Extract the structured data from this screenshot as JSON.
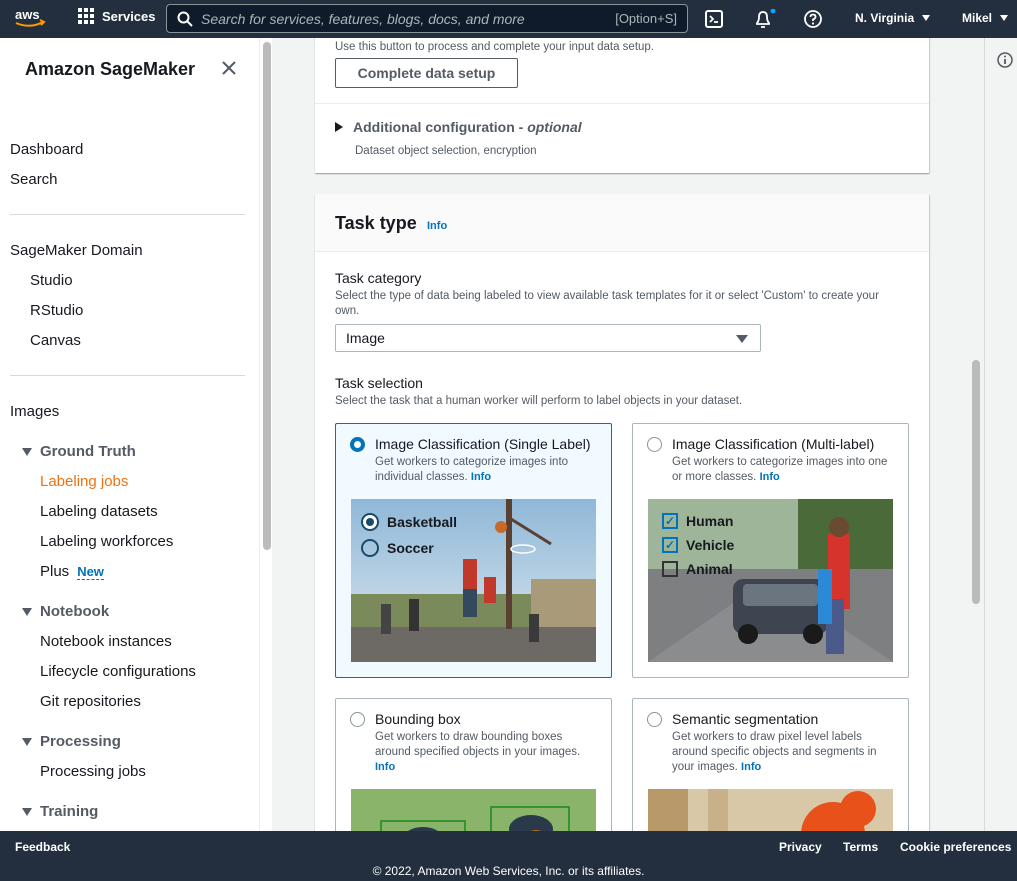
{
  "topnav": {
    "logo_text": "aws",
    "services_label": "Services",
    "search_placeholder": "Search for services, features, blogs, docs, and more",
    "search_shortcut": "[Option+S]",
    "region": "N. Virginia",
    "user": "Mikel"
  },
  "sidebar": {
    "title": "Amazon SageMaker",
    "items": {
      "dashboard": "Dashboard",
      "search": "Search",
      "domain": "SageMaker Domain",
      "studio": "Studio",
      "rstudio": "RStudio",
      "canvas": "Canvas",
      "images": "Images"
    },
    "groups": {
      "ground_truth": "Ground Truth",
      "labeling_jobs": "Labeling jobs",
      "labeling_datasets": "Labeling datasets",
      "labeling_workforces": "Labeling workforces",
      "plus": "Plus",
      "plus_badge": "New",
      "notebook": "Notebook",
      "notebook_instances": "Notebook instances",
      "lifecycle": "Lifecycle configurations",
      "git": "Git repositories",
      "processing": "Processing",
      "processing_jobs": "Processing jobs",
      "training": "Training"
    }
  },
  "data_setup": {
    "hint": "Use this button to process and complete your input data setup.",
    "button": "Complete data setup",
    "additional_title": "Additional configuration - ",
    "additional_italic": "optional",
    "additional_desc": "Dataset object selection, encryption"
  },
  "task_type": {
    "title": "Task type",
    "info": "Info",
    "category_label": "Task category",
    "category_desc": "Select the type of data being labeled to view available task templates for it or select 'Custom' to create your own.",
    "category_value": "Image",
    "selection_label": "Task selection",
    "selection_desc": "Select the task that a human worker will perform to label objects in your dataset.",
    "tiles": [
      {
        "title": "Image Classification (Single Label)",
        "desc": "Get workers to categorize images into individual classes.",
        "info": "Info",
        "selected": true,
        "options": [
          "Basketball",
          "Soccer"
        ]
      },
      {
        "title": "Image Classification (Multi-label)",
        "desc": "Get workers to categorize images into one or more classes.",
        "info": "Info",
        "selected": false,
        "options": [
          "Human",
          "Vehicle",
          "Animal"
        ]
      },
      {
        "title": "Bounding box",
        "desc": "Get workers to draw bounding boxes around specified objects in your images.",
        "info": "Info",
        "selected": false
      },
      {
        "title": "Semantic segmentation",
        "desc": "Get workers to draw pixel level labels around specific objects and segments in your images.",
        "info": "Info",
        "selected": false
      }
    ]
  },
  "footer": {
    "feedback": "Feedback",
    "privacy": "Privacy",
    "terms": "Terms",
    "cookies": "Cookie preferences",
    "copyright": "© 2022, Amazon Web Services, Inc. or its affiliates."
  },
  "colors": {
    "nav_bg": "#232f3e",
    "link": "#0073bb",
    "active": "#ec7211"
  }
}
